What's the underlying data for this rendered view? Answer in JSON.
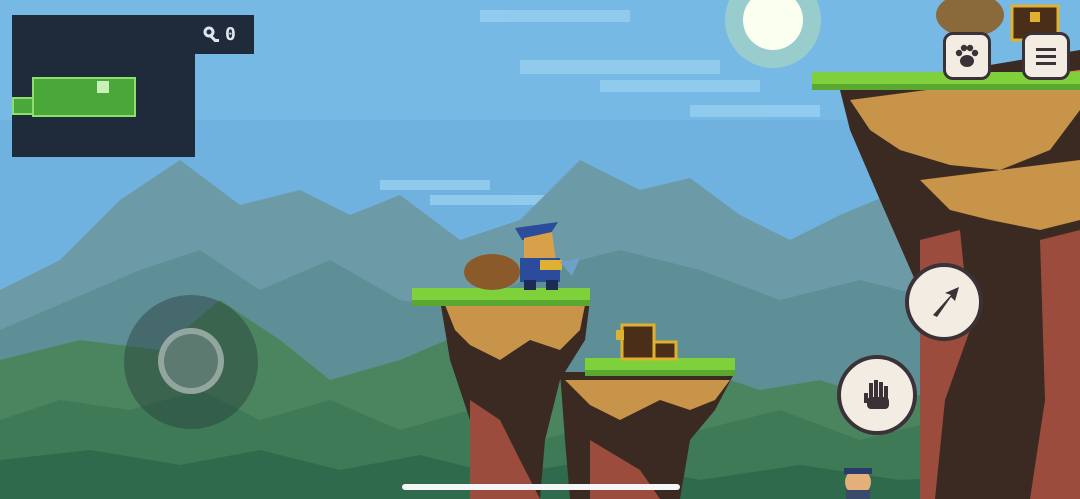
{
  "hud": {
    "key_count": "0",
    "key_icon": "key-icon",
    "pet_button_icon": "paw-icon",
    "menu_button_icon": "hamburger-menu-icon",
    "dash_button_icon": "dash-arrow-icon",
    "grab_button_icon": "hand-icon"
  },
  "minimap": {
    "current_room_color": "#4aa83a",
    "border_color": "#8ee06e"
  },
  "colors": {
    "sky": "#6fb2e0",
    "grass": "#7fd13b",
    "rock": "#c8944a",
    "rock_dark": "#3a2a22",
    "mountain_far": "#6a9aa0",
    "forest": "#3d7a55",
    "chest": "#4a2e18",
    "chest_trim": "#e0b030"
  }
}
